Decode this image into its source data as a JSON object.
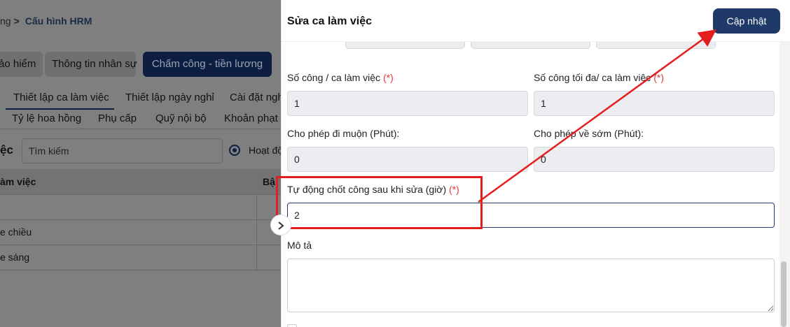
{
  "background": {
    "breadcrumb": {
      "prev": "ng",
      "current": "Cấu hình HRM"
    },
    "tabs": [
      "ảo hiểm",
      "Thông tin nhân sự",
      "Chấm công - tiền lương"
    ],
    "subtabs_row1": [
      "Thiết lập ca làm việc",
      "Thiết lập ngày nghỉ",
      "Cài đặt nghỉ"
    ],
    "subtabs_row2": [
      "Tỷ lệ hoa hồng",
      "Phụ cấp",
      "Quỹ nội bộ",
      "Khoản phạt"
    ],
    "search_label": "ệc",
    "search_placeholder": "Tìm kiếm",
    "radio_label": "Hoạt độ",
    "table": {
      "headers": [
        "àm việc",
        "Bậ"
      ],
      "rows": [
        "",
        "e chiều",
        "e sáng"
      ]
    }
  },
  "drawer": {
    "title": "Sửa ca làm việc",
    "update_button": "Cập nhật",
    "fields": {
      "work_units_label": "Số công / ca làm việc",
      "work_units_value": "1",
      "max_units_label": "Số công tối đa/ ca làm việc",
      "max_units_value": "1",
      "late_label": "Cho phép đi muộn (Phút):",
      "late_value": "0",
      "early_label": "Cho phép về sớm (Phút):",
      "early_value": "0",
      "auto_close_label": "Tự động chốt công sau khi sửa (giờ)",
      "auto_close_value": "2",
      "description_label": "Mô tả",
      "description_value": ""
    },
    "required_mark": "(*)"
  },
  "colors": {
    "primary": "#1f3a68",
    "required": "#e0383c",
    "annotation": "#e41d1d"
  },
  "icons": {
    "collapse": "chevron-right-icon",
    "breadcrumb_separator": "chevron-right-icon"
  }
}
